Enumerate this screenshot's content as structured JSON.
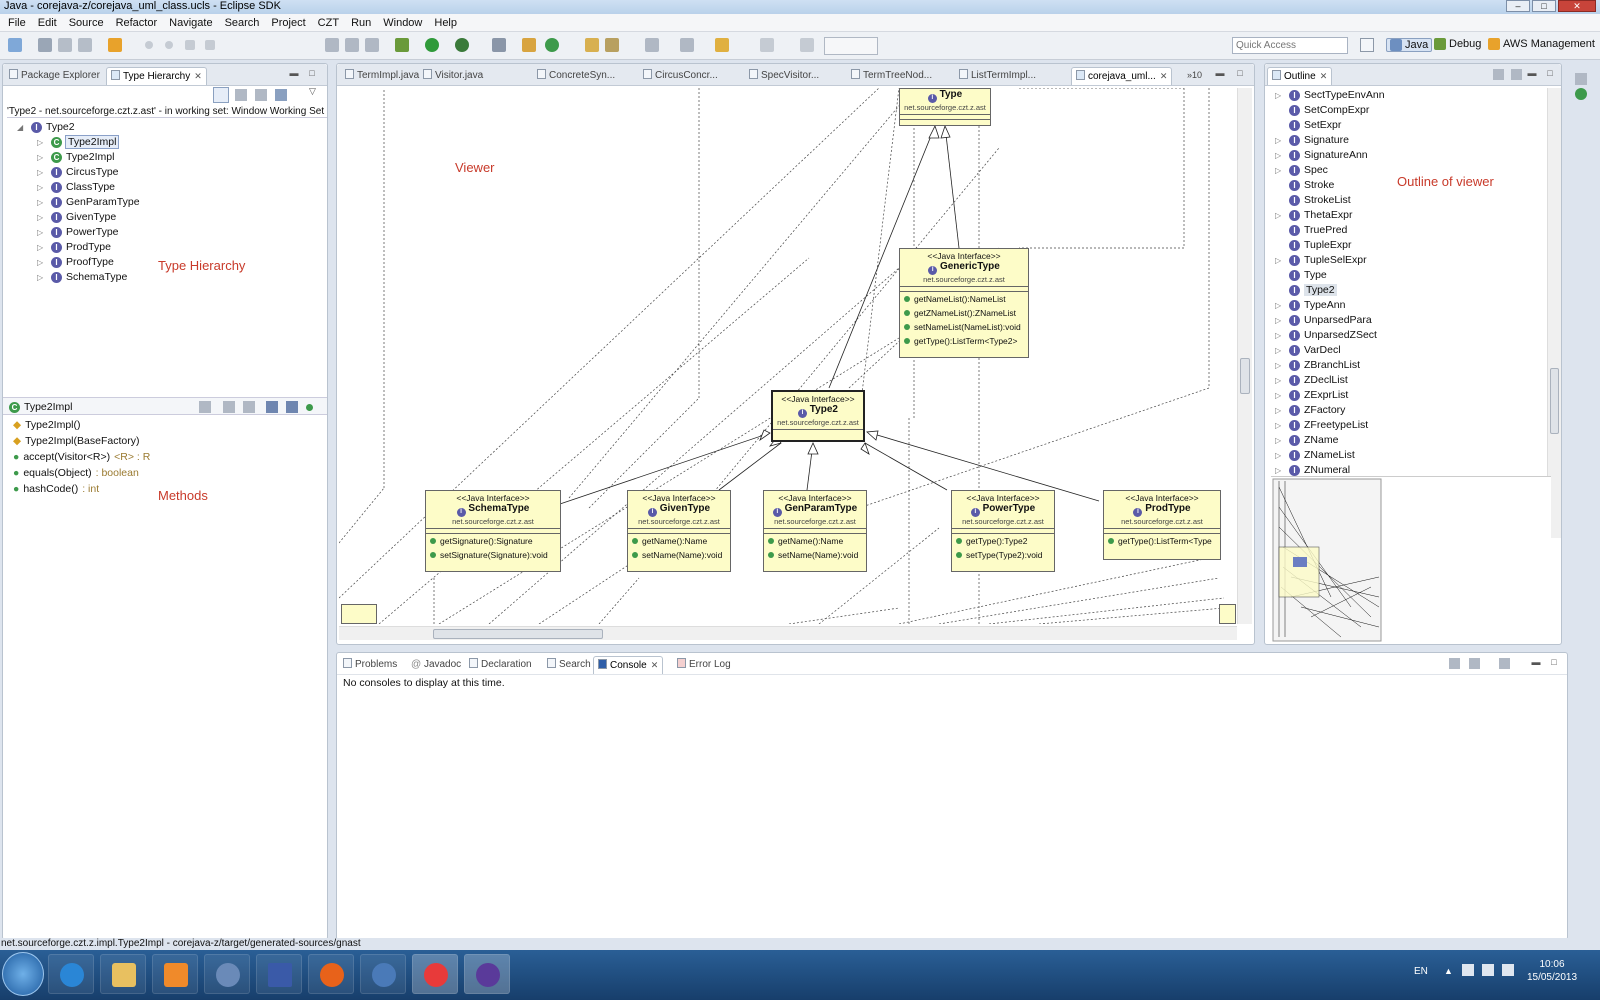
{
  "window": {
    "title": "Java - corejava-z/corejava_uml_class.ucls - Eclipse SDK"
  },
  "menu": [
    "File",
    "Edit",
    "Source",
    "Refactor",
    "Navigate",
    "Search",
    "Project",
    "CZT",
    "Run",
    "Window",
    "Help"
  ],
  "toolbar": {
    "quick_access_placeholder": "Quick Access",
    "perspectives": [
      "Java",
      "Debug",
      "AWS Management"
    ]
  },
  "left_panel": {
    "tabs": [
      "Package Explorer",
      "Type Hierarchy"
    ],
    "info": "'Type2 - net.sourceforge.czt.z.ast' - in working set: Window Working Set",
    "root": "Type2",
    "items": [
      "Type2Impl",
      "Type2Impl",
      "CircusType",
      "ClassType",
      "GenParamType",
      "GivenType",
      "PowerType",
      "ProdType",
      "ProofType",
      "SchemaType"
    ],
    "annotation": "Type Hierarchy"
  },
  "members_panel": {
    "title": "Type2Impl",
    "members": [
      {
        "name": "Type2Impl()",
        "type": ""
      },
      {
        "name": "Type2Impl(BaseFactory)",
        "type": ""
      },
      {
        "name": "accept(Visitor<R>)",
        "type": "<R> : R"
      },
      {
        "name": "equals(Object)",
        "type": " : boolean"
      },
      {
        "name": "hashCode()",
        "type": " : int"
      }
    ],
    "annotation": "Methods"
  },
  "editor": {
    "tabs": [
      "TermImpl.java",
      "Visitor.java",
      "ConcreteSyn...",
      "CircusConcr...",
      "SpecVisitor...",
      "TermTreeNod...",
      "ListTermImpl...",
      "corejava_uml..."
    ],
    "overflow": "10",
    "annotation": "Viewer",
    "diagram": {
      "type_box": {
        "name": "Type",
        "pkg": "net.sourceforge.czt.z.ast"
      },
      "generic_type": {
        "stereo": "<<Java Interface>>",
        "name": "GenericType",
        "pkg": "net.sourceforge.czt.z.ast",
        "methods": [
          "getNameList():NameList",
          "getZNameList():ZNameList",
          "setNameList(NameList):void",
          "getType():ListTerm<Type2>"
        ]
      },
      "type2": {
        "stereo": "<<Java Interface>>",
        "name": "Type2",
        "pkg": "net.sourceforge.czt.z.ast"
      },
      "schema_type": {
        "stereo": "<<Java Interface>>",
        "name": "SchemaType",
        "pkg": "net.sourceforge.czt.z.ast",
        "methods": [
          "getSignature():Signature",
          "setSignature(Signature):void"
        ]
      },
      "given_type": {
        "stereo": "<<Java Interface>>",
        "name": "GivenType",
        "pkg": "net.sourceforge.czt.z.ast",
        "methods": [
          "getName():Name",
          "setName(Name):void"
        ]
      },
      "gen_param_type": {
        "stereo": "<<Java Interface>>",
        "name": "GenParamType",
        "pkg": "net.sourceforge.czt.z.ast",
        "methods": [
          "getName():Name",
          "setName(Name):void"
        ]
      },
      "power_type": {
        "stereo": "<<Java Interface>>",
        "name": "PowerType",
        "pkg": "net.sourceforge.czt.z.ast",
        "methods": [
          "getType():Type2",
          "setType(Type2):void"
        ]
      },
      "prod_type": {
        "stereo": "<<Java Interface>>",
        "name": "ProdType",
        "pkg": "net.sourceforge.czt.z.ast",
        "methods": [
          "getType():ListTerm<Type"
        ]
      }
    }
  },
  "outline": {
    "tab": "Outline",
    "annotation": "Outline of viewer",
    "items": [
      "SectTypeEnvAnn",
      "SetCompExpr",
      "SetExpr",
      "Signature",
      "SignatureAnn",
      "Spec",
      "Stroke",
      "StrokeList",
      "ThetaExpr",
      "TruePred",
      "TupleExpr",
      "TupleSelExpr",
      "Type",
      "Type2",
      "TypeAnn",
      "UnparsedPara",
      "UnparsedZSect",
      "VarDecl",
      "ZBranchList",
      "ZDeclList",
      "ZExprList",
      "ZFactory",
      "ZFreetypeList",
      "ZName",
      "ZNameList",
      "ZNumeral"
    ],
    "selected": "Type2"
  },
  "bottom_panel": {
    "tabs": [
      "Problems",
      "Javadoc",
      "Declaration",
      "Search",
      "Console",
      "Error Log"
    ],
    "active": "Console",
    "message": "No consoles to display at this time."
  },
  "status_bar": {
    "text": "net.sourceforge.czt.z.impl.Type2Impl - corejava-z/target/generated-sources/gnast"
  },
  "taskbar": {
    "lang": "EN",
    "time": "10:06",
    "date": "15/05/2013"
  }
}
